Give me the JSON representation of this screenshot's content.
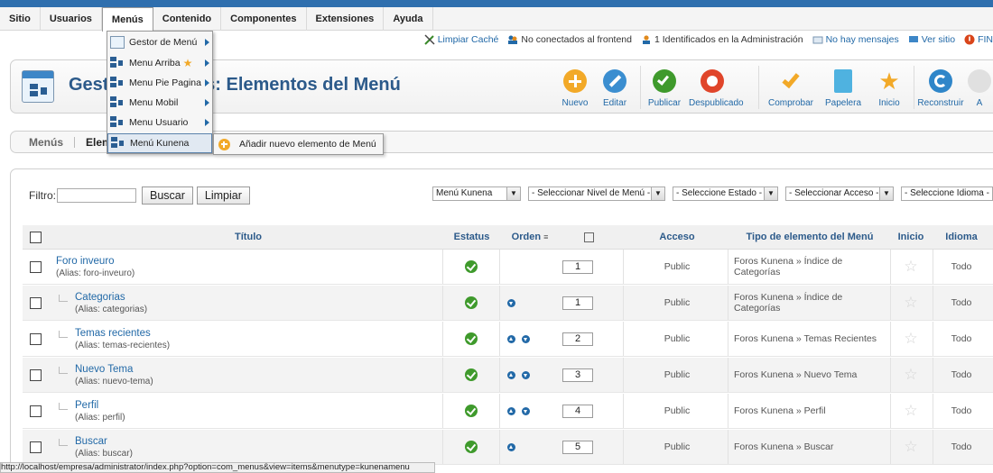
{
  "colors": {
    "accent": "#2269a7",
    "title": "#2c5a8a",
    "published": "#3f9a2c",
    "topbar": "#2f6fae"
  },
  "menubar": {
    "items": [
      {
        "label": "Sitio"
      },
      {
        "label": "Usuarios"
      },
      {
        "label": "Menús"
      },
      {
        "label": "Contenido"
      },
      {
        "label": "Componentes"
      },
      {
        "label": "Extensiones"
      },
      {
        "label": "Ayuda"
      }
    ]
  },
  "status": {
    "clear_cache": "Limpiar Caché",
    "frontend": "No conectados al frontend",
    "admin": "1 Identificados en la Administración",
    "messages": "No hay mensajes",
    "view_site": "Ver sitio",
    "logout": "FIN"
  },
  "header": {
    "title": "Gestor de Menús: Elementos del Menú"
  },
  "toolbar": {
    "nuevo": "Nuevo",
    "editar": "Editar",
    "publicar": "Publicar",
    "despublicado": "Despublicado",
    "comprobar": "Comprobar",
    "papelera": "Papelera",
    "inicio": "Inicio",
    "reconstruir": "Reconstruir",
    "ayuda": "A"
  },
  "subnav": {
    "menus": "Menús",
    "elements": "Elementos del Menú"
  },
  "dropdown": {
    "items": [
      {
        "label": "Gestor de Menú"
      },
      {
        "label": "Menu Arriba"
      },
      {
        "label": "Menu Pie Pagina"
      },
      {
        "label": "Menu Mobil"
      },
      {
        "label": "Menu Usuario"
      },
      {
        "label": "Menú Kunena"
      }
    ],
    "submenu_label": "Añadir nuevo elemento de Menú"
  },
  "filter": {
    "label": "Filtro:",
    "value": "",
    "search_button": "Buscar",
    "clear_button": "Limpiar",
    "menu_select": "Menú Kunena",
    "level_select": "- Seleccionar Nivel de Menú -",
    "state_select": "- Seleccione Estado -",
    "access_select": "- Seleccionar Acceso -",
    "language_select": "- Seleccione Idioma -"
  },
  "table": {
    "headers": {
      "titulo": "Título",
      "estatus": "Estatus",
      "orden": "Orden",
      "acceso": "Acceso",
      "tipo": "Tipo de elemento del Menú",
      "inicio": "Inicio",
      "idioma": "Idioma"
    },
    "rows": [
      {
        "title": "Foro inveuro",
        "alias": "(Alias: foro-inveuro)",
        "order": "1",
        "access": "Public",
        "type": "Foros Kunena » Índice de Categorías",
        "language": "Todo"
      },
      {
        "title": "Categorias",
        "alias": "(Alias: categorias)",
        "order": "1",
        "access": "Public",
        "type": "Foros Kunena » Índice de Categorías",
        "language": "Todo"
      },
      {
        "title": "Temas recientes",
        "alias": "(Alias: temas-recientes)",
        "order": "2",
        "access": "Public",
        "type": "Foros Kunena » Temas Recientes",
        "language": "Todo"
      },
      {
        "title": "Nuevo Tema",
        "alias": "(Alias: nuevo-tema)",
        "order": "3",
        "access": "Public",
        "type": "Foros Kunena » Nuevo Tema",
        "language": "Todo"
      },
      {
        "title": "Perfil",
        "alias": "(Alias: perfil)",
        "order": "4",
        "access": "Public",
        "type": "Foros Kunena » Perfil",
        "language": "Todo"
      },
      {
        "title": "Buscar",
        "alias": "(Alias: buscar)",
        "order": "5",
        "access": "Public",
        "type": "Foros Kunena » Buscar",
        "language": "Todo"
      }
    ]
  },
  "statusbar": {
    "url": "http://localhost/empresa/administrator/index.php?option=com_menus&view=items&menutype=kunenamenu"
  }
}
